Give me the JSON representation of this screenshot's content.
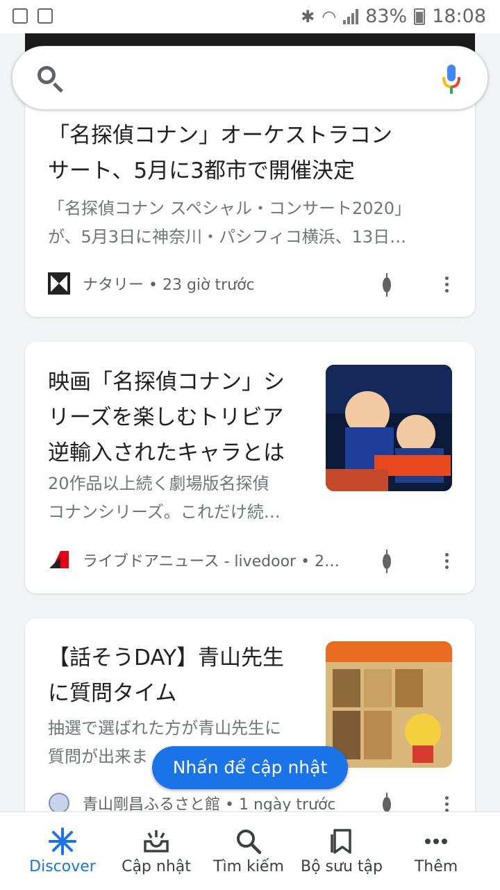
{
  "status_bar": {
    "battery": "83%",
    "time": "18:08"
  },
  "search": {
    "placeholder": ""
  },
  "cards": [
    {
      "title_line1": "「名探偵コナン」オーケストラコン",
      "title_line2": "サート、5月に3都市で開催決定",
      "snippet_line1": "「名探偵コナン スペシャル・コンサート2020」",
      "snippet_line2": "が、5月3日に神奈川・パシフィコ横浜、13日…",
      "source": "ナタリー • 23 giờ trước"
    },
    {
      "title_line1": "映画「名探偵コナン」シ",
      "title_line2": "リーズを楽しむトリビア",
      "title_line3": "逆輸入されたキャラとは",
      "snippet_line1": "20作品以上続く劇場版名探偵",
      "snippet_line2": "コナンシリーズ。これだけ続…",
      "source": "ライブドアニュース - livedoor • 2…"
    },
    {
      "title_line1": "【話そうDAY】青山先生",
      "title_line2": "に質問タイム",
      "snippet_line1": "抽選で選ばれた方が青山先生に",
      "snippet_line2": "質問が出来ま",
      "source": "青山剛昌ふるさと館 • 1 ngày trước"
    }
  ],
  "update_pill": "Nhấn để cập nhật",
  "bottom_nav": [
    {
      "label": "Discover",
      "icon": "asterisk-icon",
      "active": true
    },
    {
      "label": "Cập nhật",
      "icon": "updates-tray-icon",
      "active": false
    },
    {
      "label": "Tìm kiếm",
      "icon": "search-icon",
      "active": false
    },
    {
      "label": "Bộ sưu tập",
      "icon": "collections-icon",
      "active": false
    },
    {
      "label": "Thêm",
      "icon": "more-horiz-icon",
      "active": false
    }
  ],
  "colors": {
    "accent": "#1a73e8",
    "text": "#202124",
    "secondary": "#70757a"
  }
}
